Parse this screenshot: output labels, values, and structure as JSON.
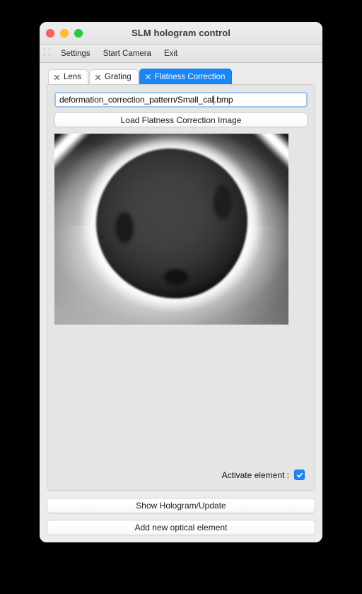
{
  "window": {
    "title": "SLM hologram control",
    "traffic_lights": [
      {
        "name": "close",
        "color": "#ff5f57"
      },
      {
        "name": "minimize",
        "color": "#febc2e"
      },
      {
        "name": "zoom",
        "color": "#28c840"
      }
    ]
  },
  "menubar": {
    "grip_icon": "drag-grip-icon",
    "items": [
      {
        "label": "Settings"
      },
      {
        "label": "Start Camera"
      },
      {
        "label": "Exit"
      }
    ]
  },
  "tabs": [
    {
      "label": "Lens",
      "active": false,
      "close_icon": "close-icon"
    },
    {
      "label": "Grating",
      "active": false,
      "close_icon": "close-icon"
    },
    {
      "label": "Flatness Correction",
      "active": true,
      "close_icon": "close-icon"
    }
  ],
  "panel": {
    "path_input": {
      "value": "deformation_correction_pattern/Small_cal.bmp",
      "value_before_caret": "deformation_correction_pattern/Small_cal",
      "value_after_caret": ".bmp",
      "placeholder": "",
      "focused": true
    },
    "load_button": {
      "label": "Load Flatness Correction Image"
    },
    "preview": {
      "name": "flatness-correction-preview",
      "description": "grayscale calibration pattern: dark irregular blob with bright white halo"
    },
    "activate": {
      "label": "Activate element :",
      "checked": true,
      "check_icon": "checkmark-icon"
    }
  },
  "bottom_buttons": [
    {
      "label": "Show Hologram/Update"
    },
    {
      "label": "Add new optical element"
    }
  ],
  "colors": {
    "accent": "#1a86f8",
    "window_bg": "#ececec",
    "panel_bg": "#e5e5e5",
    "titlebar_bg": "#e8e8e8",
    "desktop_bg": "#000000"
  }
}
